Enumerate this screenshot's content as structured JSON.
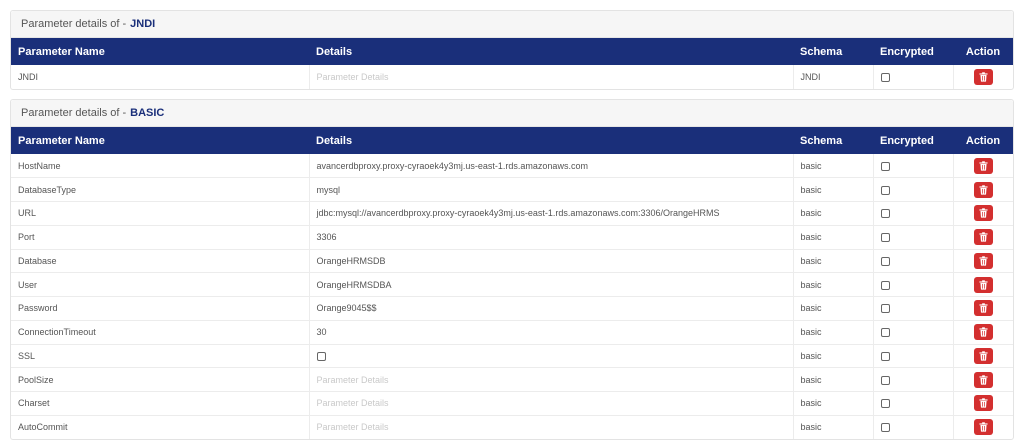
{
  "headers": {
    "name": "Parameter Name",
    "details": "Details",
    "schema": "Schema",
    "encrypted": "Encrypted",
    "action": "Action"
  },
  "sections": [
    {
      "heading_prefix": "Parameter details of -",
      "context": "JNDI",
      "rows": [
        {
          "name": "JNDI",
          "details": "",
          "placeholder": "Parameter Details",
          "schema": "JNDI",
          "encrypted": false
        }
      ]
    },
    {
      "heading_prefix": "Parameter details of -",
      "context": "BASIC",
      "rows": [
        {
          "name": "HostName",
          "details": "avancerdbproxy.proxy-cyraoek4y3mj.us-east-1.rds.amazonaws.com",
          "placeholder": "Parameter Details",
          "schema": "basic",
          "encrypted": false
        },
        {
          "name": "DatabaseType",
          "details": "mysql",
          "placeholder": "Parameter Details",
          "schema": "basic",
          "encrypted": false
        },
        {
          "name": "URL",
          "details": "jdbc:mysql://avancerdbproxy.proxy-cyraoek4y3mj.us-east-1.rds.amazonaws.com:3306/OrangeHRMS",
          "placeholder": "Parameter Details",
          "schema": "basic",
          "encrypted": false
        },
        {
          "name": "Port",
          "details": "3306",
          "placeholder": "Parameter Details",
          "schema": "basic",
          "encrypted": false
        },
        {
          "name": "Database",
          "details": "OrangeHRMSDB",
          "placeholder": "Parameter Details",
          "schema": "basic",
          "encrypted": false
        },
        {
          "name": "User",
          "details": "OrangeHRMSDBA",
          "placeholder": "Parameter Details",
          "schema": "basic",
          "encrypted": false
        },
        {
          "name": "Password",
          "details": "Orange9045$$",
          "placeholder": "Parameter Details",
          "schema": "basic",
          "encrypted": false
        },
        {
          "name": "ConnectionTimeout",
          "details": "30",
          "placeholder": "Parameter Details",
          "schema": "basic",
          "encrypted": false
        },
        {
          "name": "SSL",
          "details": "",
          "detail_checkbox": false,
          "placeholder": "",
          "schema": "basic",
          "encrypted": false
        },
        {
          "name": "PoolSize",
          "details": "",
          "placeholder": "Parameter Details",
          "schema": "basic",
          "encrypted": false
        },
        {
          "name": "Charset",
          "details": "",
          "placeholder": "Parameter Details",
          "schema": "basic",
          "encrypted": false
        },
        {
          "name": "AutoCommit",
          "details": "",
          "placeholder": "Parameter Details",
          "schema": "basic",
          "encrypted": false
        }
      ]
    }
  ],
  "icons": {
    "encrypted": "checkbox-icon",
    "delete": "trash-icon"
  },
  "colors": {
    "header_bg": "#1a2f7a",
    "delete_bg": "#d32f2f",
    "placeholder": "#c9c9c9"
  }
}
